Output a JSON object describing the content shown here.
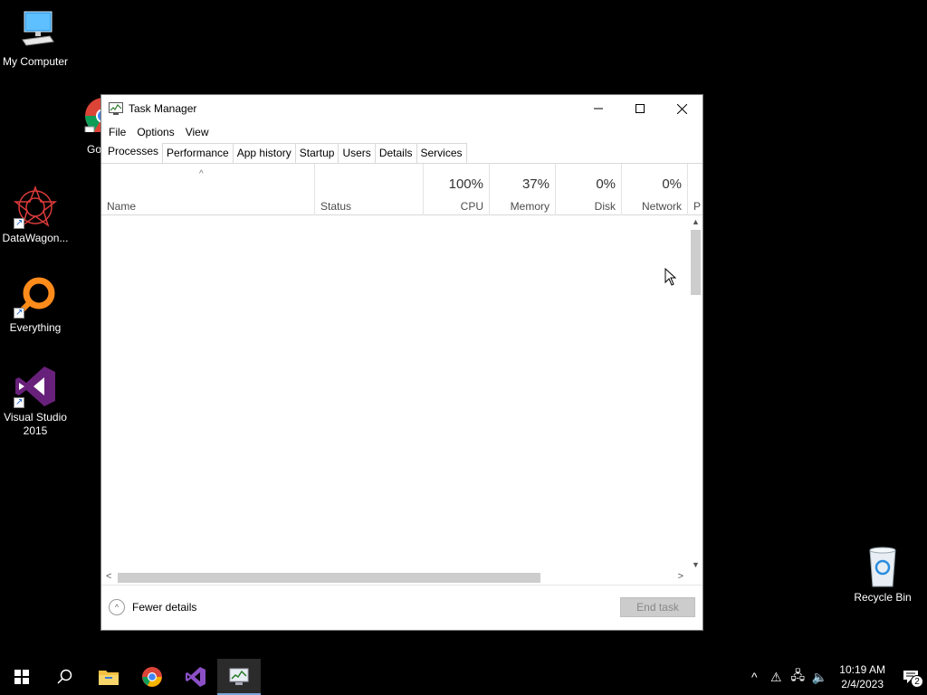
{
  "desktop": {
    "icons": [
      {
        "label": "My Computer"
      },
      {
        "label": "DataWagon..."
      },
      {
        "label": "Everything"
      },
      {
        "label": "Visual Studio 2015"
      },
      {
        "label": "Recycle Bin"
      }
    ],
    "chrome_partial": "Go Ch"
  },
  "window": {
    "title": "Task Manager",
    "menu": [
      "File",
      "Options",
      "View"
    ],
    "tabs": [
      "Processes",
      "Performance",
      "App history",
      "Startup",
      "Users",
      "Details",
      "Services"
    ],
    "active_tab": "Processes",
    "columns": {
      "name": "Name",
      "status": "Status",
      "cpu": {
        "pct": "100%",
        "label": "CPU"
      },
      "memory": {
        "pct": "37%",
        "label": "Memory"
      },
      "disk": {
        "pct": "0%",
        "label": "Disk"
      },
      "network": {
        "pct": "0%",
        "label": "Network"
      },
      "power_partial": "P"
    },
    "footer": {
      "fewer_details": "Fewer details",
      "end_task": "End task"
    }
  },
  "taskbar": {
    "clock_time": "10:19 AM",
    "clock_date": "2/4/2023",
    "notification_count": "2"
  }
}
